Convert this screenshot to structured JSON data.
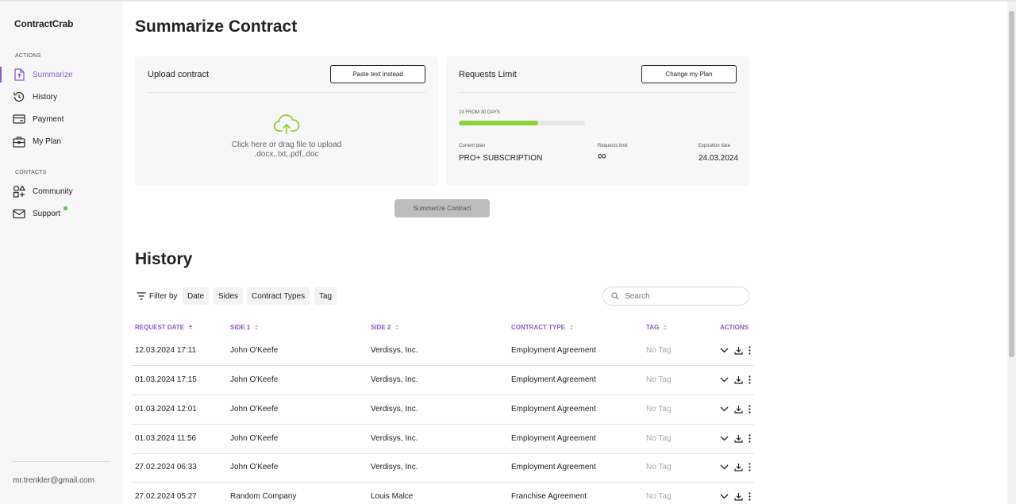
{
  "app": {
    "name": "ContractCrab"
  },
  "sidebar": {
    "actions_label": "ACTIONS",
    "actions": [
      {
        "label": "Summarize",
        "icon": "file-upload-icon",
        "active": true
      },
      {
        "label": "History",
        "icon": "history-icon",
        "active": false
      },
      {
        "label": "Payment",
        "icon": "card-icon",
        "active": false
      },
      {
        "label": "My Plan",
        "icon": "briefcase-icon",
        "active": false
      }
    ],
    "contacts_label": "CONTACTS",
    "contacts": [
      {
        "label": "Community",
        "icon": "shapes-icon"
      },
      {
        "label": "Support",
        "icon": "mail-icon",
        "online_dot": true
      }
    ],
    "user_email": "mr.trenkler@gmail.com"
  },
  "summarize": {
    "title": "Summarize Contract",
    "upload": {
      "title": "Upload contract",
      "paste_button": "Paste text instead",
      "hint": "Click here or drag file to upload",
      "formats": ".docx,.txt,.pdf,.doc"
    },
    "limit": {
      "title": "Requests Limit",
      "change_button": "Change my Plan",
      "usage_label": "19 FROM 30 DAYS",
      "usage_fraction": 0.63,
      "current_plan_label": "Current plan",
      "current_plan_value": "PRO+ SUBSCRIPTION",
      "requests_limit_label": "Requests limit",
      "requests_limit_value": "∞",
      "expiration_label": "Expiration date",
      "expiration_value": "24.03.2024"
    },
    "submit_button": "Summarize Contract"
  },
  "history": {
    "title": "History",
    "filter_by": "Filter by",
    "filters": [
      "Date",
      "Sides",
      "Contract Types",
      "Tag"
    ],
    "search_placeholder": "Search",
    "columns": {
      "request_date": "REQUEST DATE",
      "side1": "SIDE 1",
      "side2": "SIDE 2",
      "contract_type": "CONTRACT TYPE",
      "tag": "TAG",
      "actions": "ACTIONS"
    },
    "rows": [
      {
        "date": "12.03.2024 17:11",
        "side1": "John O'Keefe",
        "side2": "Verdisys, Inc.",
        "type": "Employment Agreement",
        "tag": "No Tag"
      },
      {
        "date": "01.03.2024 17:15",
        "side1": "John O'Keefe",
        "side2": "Verdisys, Inc.",
        "type": "Employment Agreement",
        "tag": "No Tag"
      },
      {
        "date": "01.03.2024 12:01",
        "side1": "John O'Keefe",
        "side2": "Verdisys, Inc.",
        "type": "Employment Agreement",
        "tag": "No Tag"
      },
      {
        "date": "01.03.2024 11:56",
        "side1": "John O'Keefe",
        "side2": "Verdisys, Inc.",
        "type": "Employment Agreement",
        "tag": "No Tag"
      },
      {
        "date": "27.02.2024 06:33",
        "side1": "John O'Keefe",
        "side2": "Verdisys, Inc.",
        "type": "Employment Agreement",
        "tag": "No Tag"
      },
      {
        "date": "27.02.2024 05:27",
        "side1": "Random Company",
        "side2": "Louis Malce",
        "type": "Franchise Agreement",
        "tag": "No Tag"
      }
    ]
  },
  "colors": {
    "accent": "#8b5cc7",
    "progress": "#8fd13a",
    "online": "#5cc24a"
  }
}
